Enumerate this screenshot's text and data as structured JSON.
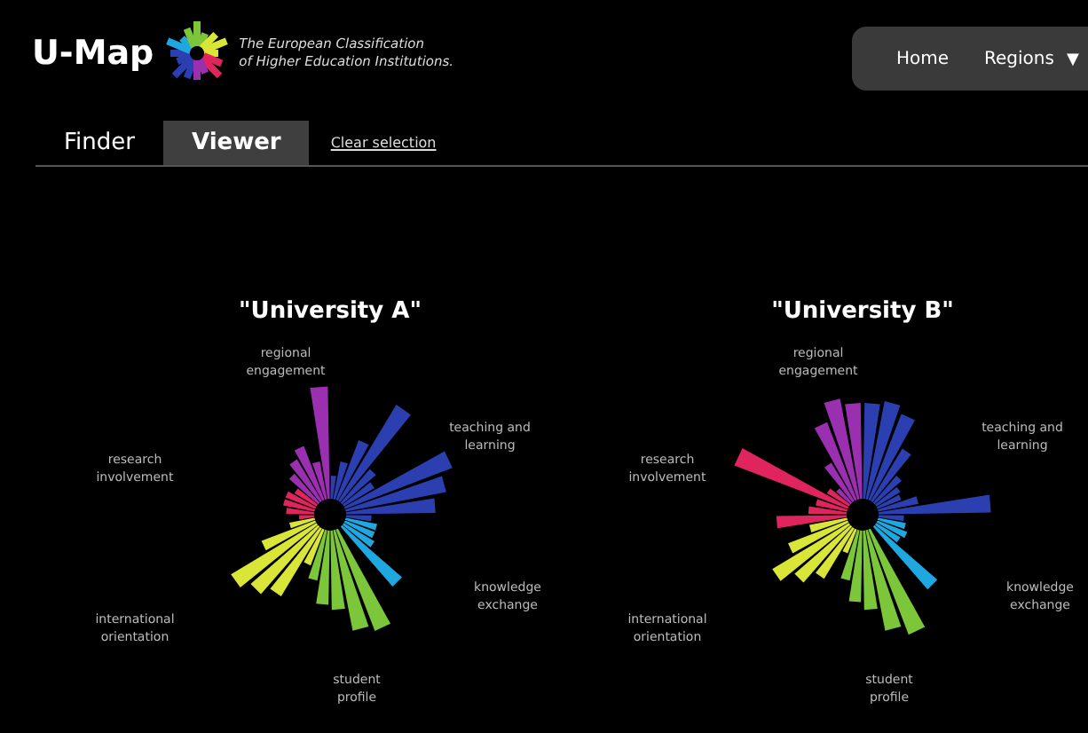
{
  "header": {
    "logo": "U-Map",
    "tagline": [
      "The European Classification",
      "of Higher Education Institutions."
    ]
  },
  "nav": [
    {
      "label": "Home"
    },
    {
      "label": "Regions",
      "caret": "▼"
    }
  ],
  "tabs": [
    {
      "label": "Finder",
      "selected": false
    },
    {
      "label": "Viewer",
      "selected": true
    }
  ],
  "clear_selection": "Clear selection",
  "charts": [
    {
      "title": "\"University A\"",
      "kind": "picture",
      "axis_labels": [
        [
          "regional",
          "engagement"
        ],
        [
          "teaching and",
          "learning"
        ],
        [
          "research",
          "involvement"
        ],
        [
          "knowledge",
          "exchange"
        ],
        [
          "international",
          "orientation"
        ],
        [
          "student",
          "profile"
        ]
      ]
    },
    {
      "title": "\"University B\"",
      "kind": "picture",
      "axis_labels": [
        [
          "regional",
          "engagement"
        ],
        [
          "teaching and",
          "learning"
        ],
        [
          "research",
          "involvement"
        ],
        [
          "knowledge",
          "exchange"
        ],
        [
          "international",
          "orientation"
        ],
        [
          "student",
          "profile"
        ]
      ]
    }
  ]
}
